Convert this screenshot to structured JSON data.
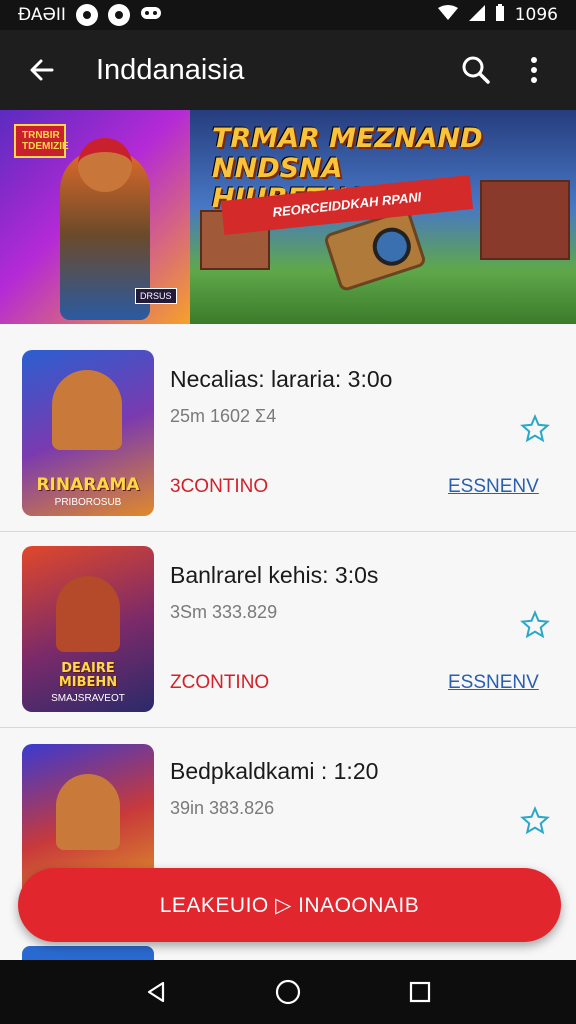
{
  "status_bar": {
    "carrier": "ÐAƏII",
    "time": "1096"
  },
  "app_bar": {
    "title": "Inddanaisia",
    "back_icon": "back-arrow-icon",
    "search_icon": "search-icon",
    "menu_icon": "more-vert-icon"
  },
  "banner": {
    "headline": "TRMAR MEZNAND NNDSNA HIUBETNA",
    "subtitle": "REORCEIDDKAH RPANI",
    "tag": "TRNBIR TDEMIZIE",
    "badge": "DRSUS"
  },
  "items": [
    {
      "title": "Necalias: lararia: 3:0o",
      "meta": "25m 1602 Σ4",
      "status": "3CONTINO",
      "action": "ESSNENV",
      "thumb_label": "RINARAMA",
      "thumb_sub": "PRIBOROSUB"
    },
    {
      "title": "Banlrarel kehis: 3:0s",
      "meta": "3Sm 333.829",
      "status": "ZCONTINO",
      "action": "ESSNENV",
      "thumb_label": "DEAIRE MIBEHN",
      "thumb_sub": "SMAJSRAVEOT"
    },
    {
      "title": "Bedpkaldkami : 1:20",
      "meta": "39in 383.826",
      "status": "",
      "action": "",
      "thumb_label": "",
      "thumb_sub": ""
    }
  ],
  "cta": {
    "label": "LEAKEUIO ▷ INAOONAIB"
  },
  "nav": {
    "back": "nav-back-icon",
    "home": "nav-home-icon",
    "recents": "nav-recents-icon"
  },
  "colors": {
    "accent_red": "#e1262e",
    "link_blue": "#2a5fb0",
    "star_teal": "#2aa8c8"
  }
}
